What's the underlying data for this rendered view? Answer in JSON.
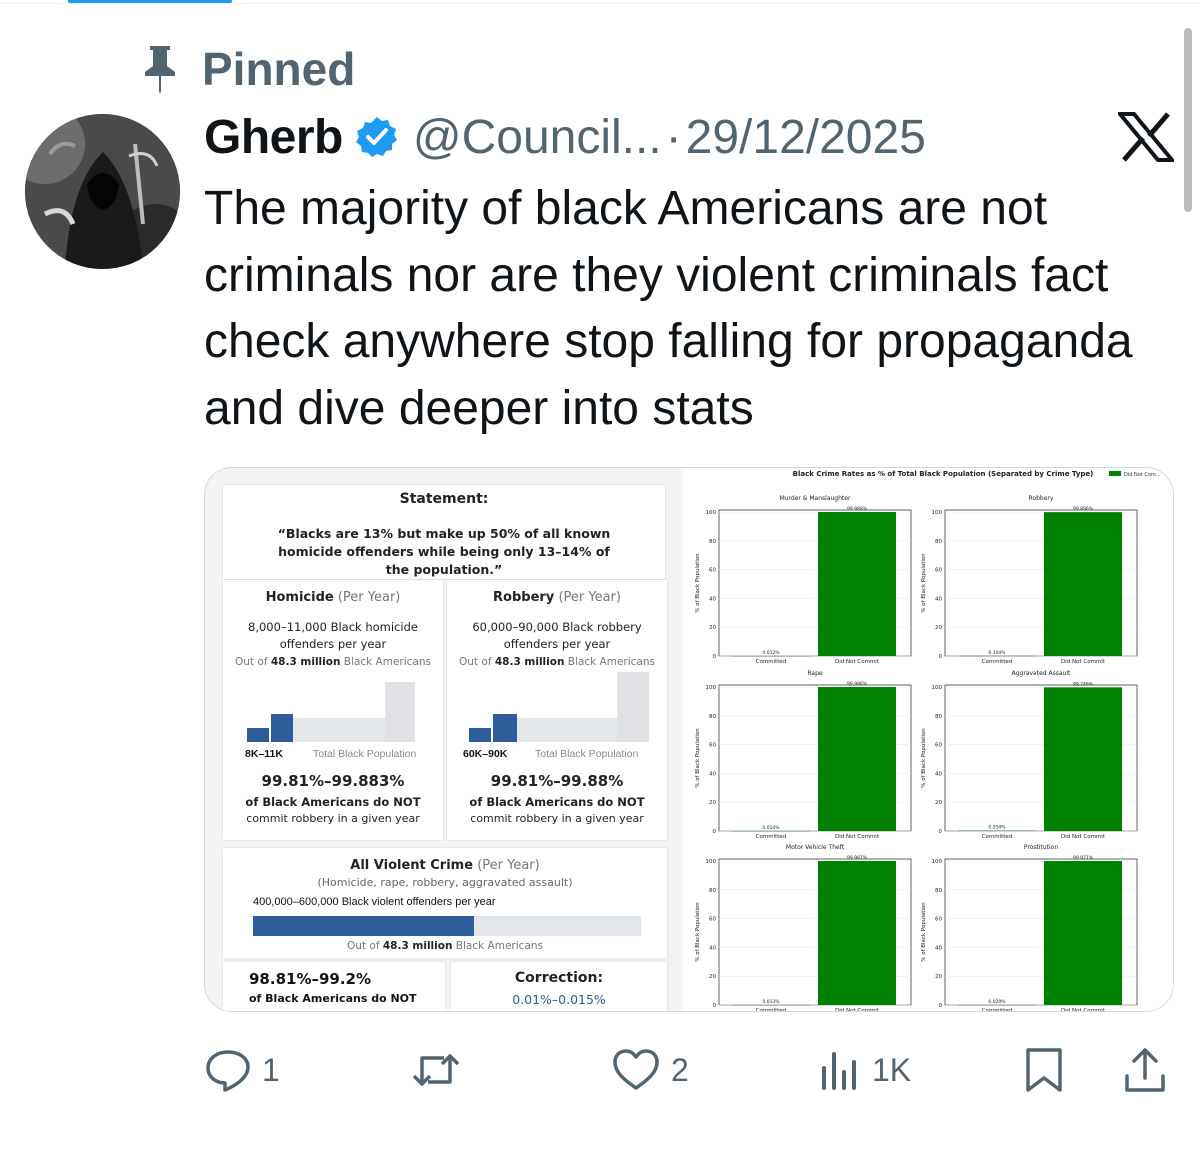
{
  "pinned_label": "Pinned",
  "author": {
    "display_name": "Gherb",
    "handle": "@Council...",
    "date_separator": "·",
    "date": "29/12/2025"
  },
  "tweet_text": "The majority of black Americans are not criminals nor are they violent criminals fact check anywhere stop falling for propaganda and dive deeper into stats",
  "infographic": {
    "statement_title": "Statement:",
    "statement_quote": "“Blacks are 13% but make up 50% of all known homicide offenders while being only 13–14% of the population.”",
    "homicide": {
      "title": "Homicide",
      "period": "(Per Year)",
      "count_line1": "8,000–11,000 Black homicide",
      "count_line2": "offenders per year",
      "outof_prefix": "Out of ",
      "outof_bold": "48.3 million",
      "outof_suffix": " Black Americans",
      "bar_label": "8K–11K",
      "pop_label": "Total Black Population",
      "pct": "99.81%–99.883%",
      "pct_line1": "of Black Americans do NOT",
      "pct_line2": "commit robbery in a given year"
    },
    "robbery": {
      "title": "Robbery",
      "period": "(Per Year)",
      "count_line1": "60,000–90,000 Black robbery",
      "count_line2": "offenders per year",
      "outof_prefix": "Out of ",
      "outof_bold": "48.3 million",
      "outof_suffix": " Black Americans",
      "bar_label": "60K–90K",
      "pop_label": "Total Black Population",
      "pct": "99.81%–99.88%",
      "pct_line1": "of Black Americans do NOT",
      "pct_line2": "commit robbery in a given year"
    },
    "violent": {
      "title": "All Violent Crime",
      "period": "(Per Year)",
      "subtitle": "(Homicide, rape, robbery, aggravated assault)",
      "count": "400,000–600,000 Black violent offenders per year",
      "outof_prefix": "Out of ",
      "outof_bold": "48.3 million",
      "outof_suffix": " Black Americans",
      "bar_fraction": 0.57
    },
    "bottom_pct": "98.81%–99.2%",
    "bottom_pct_line": "of Black Americans do NOT",
    "correction_title": "Correction:",
    "correction_value": "0.01%–0.015%"
  },
  "chart_data": {
    "type": "bar",
    "title": "Black Crime Rates as % of Total Black Population (Separated by Crime Type)",
    "legend": "Did Not Com...",
    "legend_position": "top-right",
    "ylabel": "% of Black Population",
    "ylim": [
      0,
      100
    ],
    "yticks": [
      "0",
      "20",
      "40",
      "60",
      "80",
      "100"
    ],
    "categories": [
      "Committed",
      "Did Not Commit"
    ],
    "bar_color": "#008000",
    "panels": [
      {
        "title": "Murder & Manslaughter",
        "values": [
          0.012,
          99.988
        ],
        "labels": [
          "0.012%",
          "99.988%"
        ]
      },
      {
        "title": "Robbery",
        "values": [
          0.104,
          99.896
        ],
        "labels": [
          "0.104%",
          "99.896%"
        ]
      },
      {
        "title": "Rape",
        "values": [
          0.014,
          99.986
        ],
        "labels": [
          "0.014%",
          "99.986%"
        ]
      },
      {
        "title": "Aggravated Assault",
        "values": [
          0.254,
          99.746
        ],
        "labels": [
          "0.254%",
          "99.746%"
        ]
      },
      {
        "title": "Motor Vehicle Theft",
        "values": [
          0.013,
          99.987
        ],
        "labels": [
          "0.013%",
          "99.987%"
        ]
      },
      {
        "title": "Prostitution",
        "values": [
          0.029,
          99.971
        ],
        "labels": [
          "0.029%",
          "99.971%"
        ]
      }
    ]
  },
  "actions": {
    "reply_count": "1",
    "retweet_count": "",
    "like_count": "2",
    "views_count": "1K"
  },
  "icons": [
    "pin-icon",
    "verified-badge-icon",
    "x-logo-icon",
    "reply-icon",
    "retweet-icon",
    "like-icon",
    "views-icon",
    "bookmark-icon",
    "share-icon"
  ],
  "colors": {
    "accent": "#1d9bf0",
    "text_primary": "#0f1419",
    "text_secondary": "#536471",
    "infographic_blue": "#2e5e9a"
  }
}
